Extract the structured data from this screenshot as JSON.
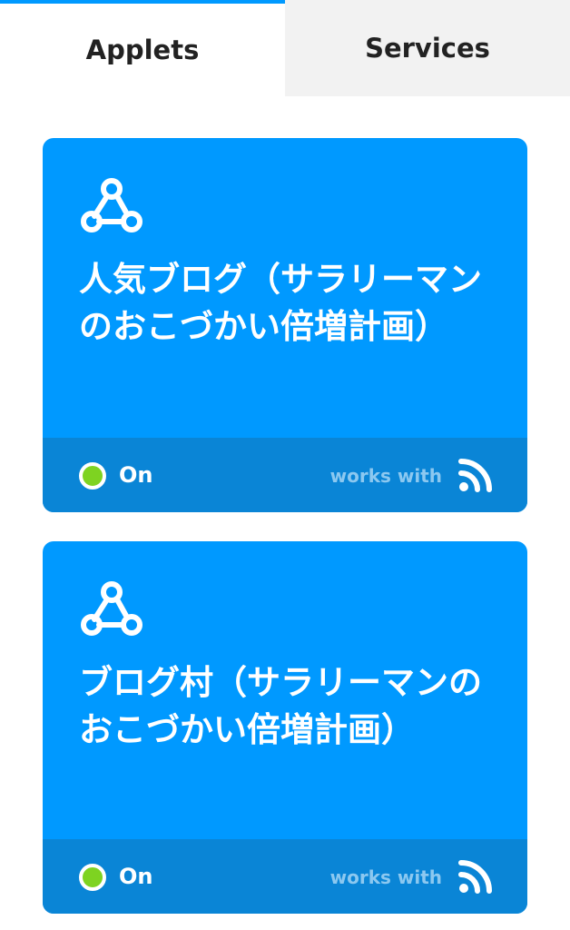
{
  "tabs": {
    "applets": "Applets",
    "services": "Services"
  },
  "applets": [
    {
      "title": "人気ブログ（サラリーマンのおこづかい倍増計画）",
      "status": "On",
      "works_with": "works with",
      "icon": "webhook-icon",
      "service_icon": "rss-icon"
    },
    {
      "title": "ブログ村（サラリーマンのおこづかい倍増計画）",
      "status": "On",
      "works_with": "works with",
      "icon": "webhook-icon",
      "service_icon": "rss-icon"
    }
  ],
  "colors": {
    "accent": "#0099ff",
    "card_footer": "#0a85d6",
    "status_on": "#7ed321",
    "inactive_tab": "#f2f2f2"
  }
}
